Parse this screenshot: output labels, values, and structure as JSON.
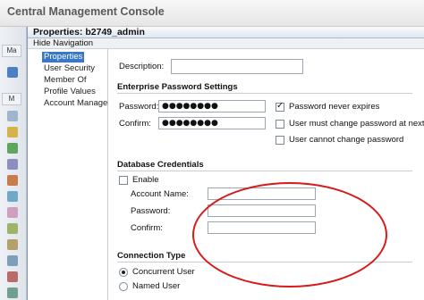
{
  "app": {
    "title": "Central Management Console"
  },
  "rail": {
    "tabs": [
      "Ma",
      "M"
    ]
  },
  "dialog": {
    "title": "Properties: b2749_admin",
    "hide_navigation": "Hide Navigation",
    "nav": [
      "Properties",
      "User Security",
      "Member Of",
      "Profile Values",
      "Account Manager"
    ]
  },
  "form": {
    "cut_text": "..................................",
    "description": {
      "label": "Description:",
      "value": ""
    },
    "enterprise": {
      "title": "Enterprise Password Settings",
      "password": {
        "label": "Password:",
        "value": "●●●●●●●●"
      },
      "confirm": {
        "label": "Confirm:",
        "value": "●●●●●●●●"
      },
      "options": [
        {
          "label": "Password never expires",
          "checked": true
        },
        {
          "label": "User must change password at next logon",
          "checked": false
        },
        {
          "label": "User cannot change password",
          "checked": false
        }
      ]
    },
    "database": {
      "title": "Database Credentials",
      "enable_label": "Enable",
      "enable_checked": false,
      "account_name": {
        "label": "Account Name:",
        "value": ""
      },
      "password": {
        "label": "Password:",
        "value": ""
      },
      "confirm": {
        "label": "Confirm:",
        "value": ""
      }
    },
    "connection": {
      "title": "Connection Type",
      "options": [
        {
          "label": "Concurrent User",
          "selected": true
        },
        {
          "label": "Named User",
          "selected": false
        }
      ]
    }
  },
  "colors": {
    "annotation": "#d81a1a",
    "selected_nav": "#3a77c4"
  }
}
